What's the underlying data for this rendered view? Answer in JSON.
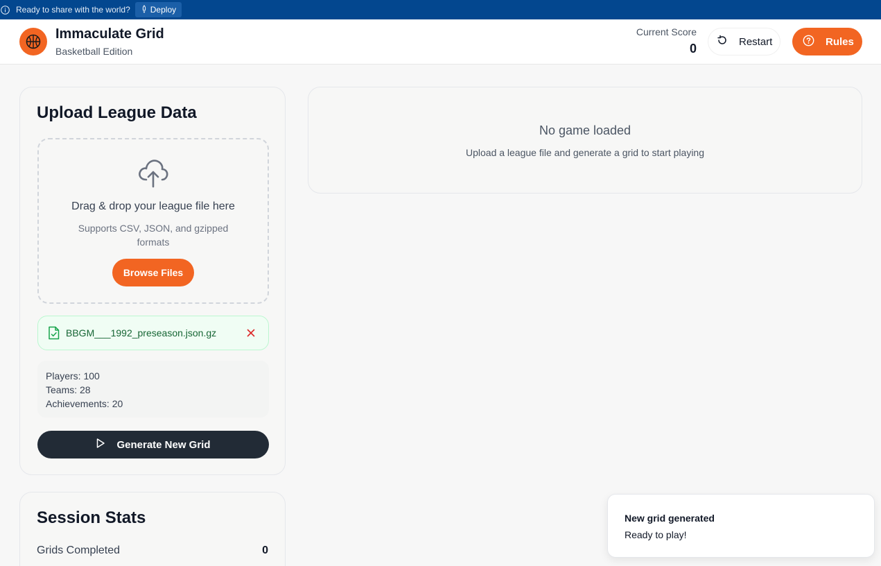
{
  "deploy_bar": {
    "message": "Ready to share with the world?",
    "deploy_label": "Deploy"
  },
  "header": {
    "title": "Immaculate Grid",
    "subtitle": "Basketball Edition",
    "score_label": "Current Score",
    "score_value": "0",
    "restart_label": "Restart",
    "rules_label": "Rules"
  },
  "upload": {
    "title": "Upload League Data",
    "drop_title": "Drag & drop your league file here",
    "drop_subtitle": "Supports CSV, JSON, and gzipped formats",
    "browse_label": "Browse Files",
    "file_name": "BBGM___1992_preseason.json.gz",
    "stats": {
      "players": "Players: 100",
      "teams": "Teams: 28",
      "achievements": "Achievements: 20"
    },
    "generate_label": "Generate New Grid"
  },
  "session": {
    "title": "Session Stats",
    "rows": [
      {
        "label": "Grids Completed",
        "value": "0"
      }
    ]
  },
  "game": {
    "empty_title": "No game loaded",
    "empty_subtitle": "Upload a league file and generate a grid to start playing"
  },
  "toast": {
    "title": "New grid generated",
    "body": "Ready to play!"
  },
  "colors": {
    "accent": "#f26522",
    "deploy_bar": "#03478f",
    "dark_button": "#222b36",
    "success_bg": "#f0fdf4"
  }
}
